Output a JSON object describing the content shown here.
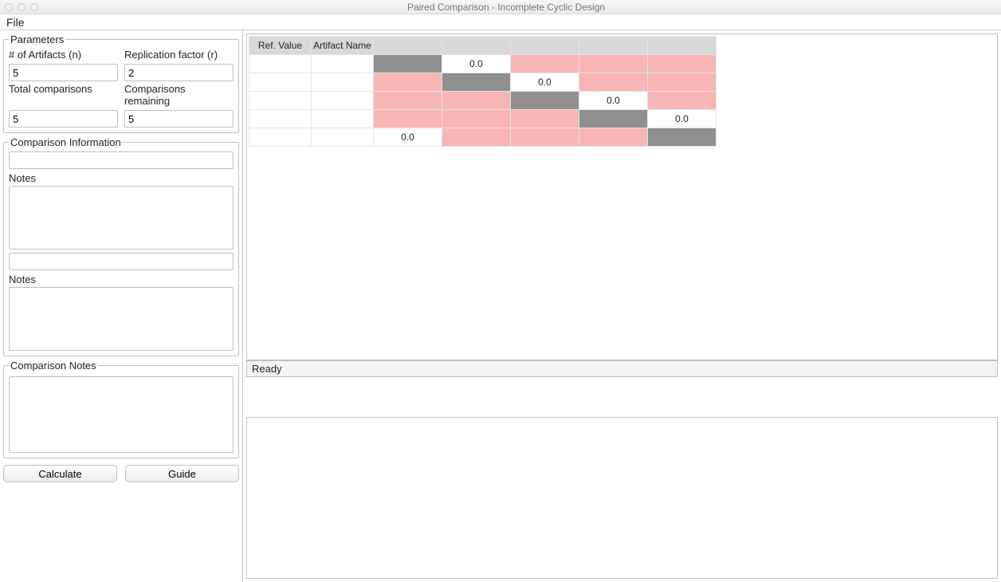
{
  "window": {
    "title": "Paired Comparison - Incomplete Cyclic Design"
  },
  "menu": {
    "file": "File"
  },
  "panels": {
    "parameters": {
      "legend": "Parameters",
      "artifacts_label": "# of Artifacts (n)",
      "artifacts_value": "5",
      "replication_label": "Replication factor (r)",
      "replication_value": "2",
      "total_label": "Total comparisons",
      "total_value": "5",
      "remaining_label": "Comparisons remaining",
      "remaining_value": "5"
    },
    "comparison_info": {
      "legend": "Comparison Information",
      "value": "",
      "notes1_label": "Notes",
      "notes2_label": "Notes"
    },
    "comparison_notes": {
      "legend": "Comparison Notes"
    }
  },
  "buttons": {
    "calculate": "Calculate",
    "guide": "Guide"
  },
  "status": "Ready",
  "matrix": {
    "headers": {
      "ref": "Ref. Value",
      "name": "Artifact Name"
    },
    "cells": {
      "r1c2": "0.0",
      "r2c3": "0.0",
      "r3c4": "0.0",
      "r4c5": "0.0",
      "r5c1": "0.0"
    }
  },
  "colors": {
    "header_gray": "#d8d8d8",
    "diag_gray": "#8f8f8f",
    "pink": "#f8b5b5"
  }
}
